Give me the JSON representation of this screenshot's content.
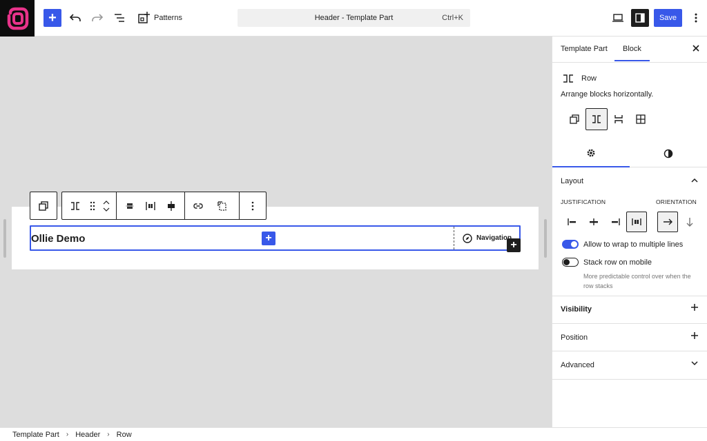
{
  "topbar": {
    "add_label": "+",
    "patterns_label": "Patterns",
    "document_title": "Header - Template Part",
    "shortcut": "Ctrl+K",
    "save_label": "Save"
  },
  "canvas": {
    "site_title": "Ollie Demo",
    "navigation_label": "Navigation"
  },
  "breadcrumbs": [
    "Template Part",
    "Header",
    "Row"
  ],
  "sidebar": {
    "tabs": [
      "Template Part",
      "Block"
    ],
    "active_tab": "Block",
    "block_name": "Row",
    "block_description": "Arrange blocks horizontally.",
    "layout_title": "Layout",
    "justification_label": "JUSTIFICATION",
    "orientation_label": "ORIENTATION",
    "wrap_label": "Allow to wrap to multiple lines",
    "wrap_on": true,
    "stack_label": "Stack row on mobile",
    "stack_on": false,
    "stack_help": "More predictable control over when the row stacks",
    "panels": [
      "Visibility",
      "Position",
      "Advanced"
    ]
  },
  "colors": {
    "accent": "#3858e9",
    "logo_pink": "#e8338a",
    "canvas_bg": "#dddddd"
  }
}
